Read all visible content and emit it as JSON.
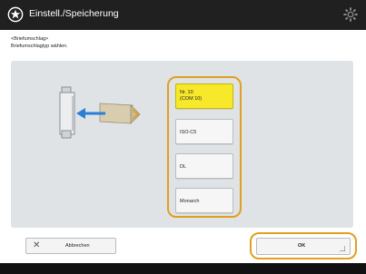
{
  "header": {
    "title": "Einstell./Speicherung",
    "title_icon": "gear-star-icon",
    "settings_icon": "settings-icon"
  },
  "instructions": {
    "line1": "<Briefumschlag>",
    "line2": "Briefumschlagtyp wählen."
  },
  "illustration": {
    "icon": "envelope-feed-icon"
  },
  "options": [
    {
      "line1": "Nr. 10",
      "line2": "(COM 10)",
      "selected": true
    },
    {
      "line1": "ISO-C5",
      "line2": "",
      "selected": false
    },
    {
      "line1": "DL",
      "line2": "",
      "selected": false
    },
    {
      "line1": "Monarch",
      "line2": "",
      "selected": false
    }
  ],
  "footer": {
    "cancel_label": "Abbrechen",
    "cancel_icon": "close-icon",
    "ok_label": "OK"
  },
  "colors": {
    "highlight": "#e0a020",
    "selected": "#f7e829",
    "topbar": "#202020"
  }
}
